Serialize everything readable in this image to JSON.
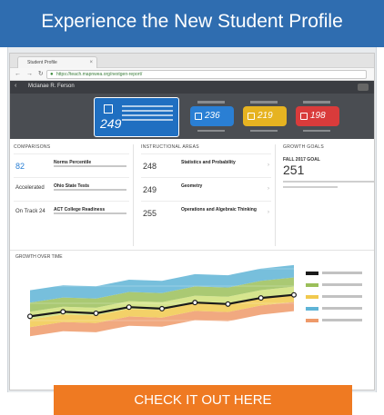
{
  "banner": {
    "title": "Experience the New Student Profile"
  },
  "browser": {
    "tab_label": "Student Profile",
    "tab_close": "×",
    "url": "https://teach.mapnwea.org/nextgen-report/"
  },
  "app_header": {
    "student_name": "Mclanae R. Ferson"
  },
  "scores": {
    "main_rit": "249",
    "blue_rit": "236",
    "yellow_rit": "219",
    "red_rit": "198"
  },
  "panels": {
    "comparisons_title": "COMPARISONS",
    "instructional_title": "INSTRUCTIONAL AREAS",
    "growth_title": "GROWTH GOALS",
    "comparisons": [
      {
        "value": "82",
        "label": "Norms Percentile"
      },
      {
        "value": "Accelerated",
        "label": "Ohio State Tests"
      },
      {
        "value": "On Track 24",
        "label": "ACT College Readiness"
      }
    ],
    "instructional": [
      {
        "value": "248",
        "label": "Statistics and Probability"
      },
      {
        "value": "249",
        "label": "Geometry"
      },
      {
        "value": "255",
        "label": "Operations and Algebraic Thinking"
      }
    ],
    "growth": {
      "label": "FALL 2017 GOAL",
      "value": "251"
    }
  },
  "chart_section": {
    "title": "GROWTH OVER TIME"
  },
  "chart_data": {
    "type": "line",
    "title": "",
    "xlabel": "",
    "ylabel": "",
    "x": [
      1,
      2,
      3,
      4,
      5,
      6,
      7,
      8,
      9
    ],
    "series": [
      {
        "values": [
          208,
          214,
          212,
          220,
          218,
          226,
          224,
          232,
          236
        ]
      }
    ],
    "bands": true,
    "ylim": [
      180,
      270
    ]
  },
  "cta": {
    "label": "CHECK IT OUT HERE"
  },
  "colors": {
    "banner": "#2f6db0",
    "cta": "#ef7a22",
    "rit_blue": "#2a7fd4",
    "rit_yellow": "#e6b321",
    "rit_red": "#d93b3b"
  }
}
